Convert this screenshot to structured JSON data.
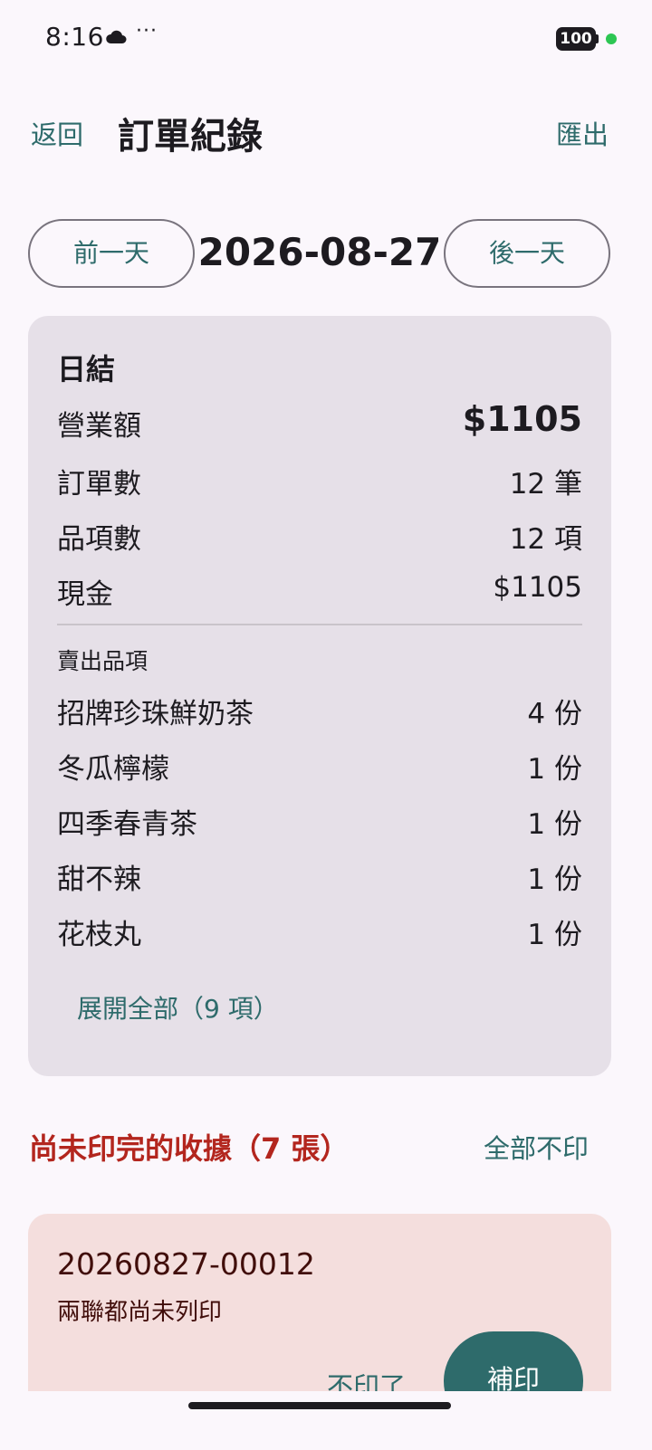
{
  "status_bar": {
    "time": "8:16",
    "more": "···",
    "battery": "100",
    "icons": [
      "cloud-icon",
      "battery-icon"
    ]
  },
  "header": {
    "back": "返回",
    "title": "訂單紀錄",
    "export": "匯出"
  },
  "date_nav": {
    "prev": "前一天",
    "date": "2026-08-27",
    "next": "後一天"
  },
  "summary": {
    "title": "日結",
    "stats": [
      {
        "label": "營業額",
        "value": "$1105"
      },
      {
        "label": "訂單數",
        "value": "12 筆"
      },
      {
        "label": "品項數",
        "value": "12 項"
      },
      {
        "label": "現金",
        "value": "$1105"
      }
    ],
    "items_section_label": "賣出品項",
    "items": [
      {
        "name": "招牌珍珠鮮奶茶",
        "qty": "4 份"
      },
      {
        "name": "冬瓜檸檬",
        "qty": "1 份"
      },
      {
        "name": "四季春青茶",
        "qty": "1 份"
      },
      {
        "name": "甜不辣",
        "qty": "1 份"
      },
      {
        "name": "花枝丸",
        "qty": "1 份"
      }
    ],
    "expand_label": "展開全部（9 項）"
  },
  "unprinted": {
    "title": "尚未印完的收據（7 張）",
    "skip_all": "全部不印",
    "receipt": {
      "id": "20260827-00012",
      "status": "兩聯都尚未列印",
      "skip": "不印了",
      "reprint": "補印"
    }
  },
  "colors": {
    "accent": "#2e6b6b",
    "warning": "#b3261e",
    "card": "#e6e0e8",
    "receipt_card": "#f4dedd"
  }
}
